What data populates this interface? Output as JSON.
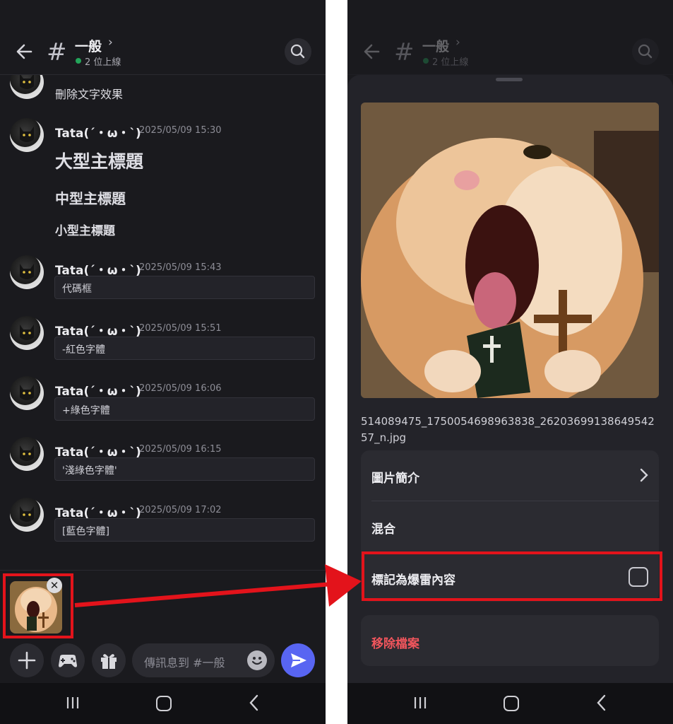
{
  "left": {
    "header": {
      "channel_name": "一般",
      "online_text": "2 位上線"
    },
    "messages": [
      {
        "author": "Tata(´・ω・`)",
        "timestamp": "2025/05/09 15:30",
        "h1": "大型主標題",
        "h2": "中型主標題",
        "h3": "小型主標題"
      },
      {
        "author": "Tata(´・ω・`)",
        "timestamp": "2025/05/09 15:43",
        "code": "代碼框"
      },
      {
        "author": "Tata(´・ω・`)",
        "timestamp": "2025/05/09 15:51",
        "code": "-紅色字體"
      },
      {
        "author": "Tata(´・ω・`)",
        "timestamp": "2025/05/09 16:06",
        "code": "+綠色字體"
      },
      {
        "author": "Tata(´・ω・`)",
        "timestamp": "2025/05/09 16:15",
        "code": "'淺綠色字體'"
      },
      {
        "author": "Tata(´・ω・`)",
        "timestamp": "2025/05/09 17:02",
        "code": "[藍色字體]"
      }
    ],
    "partial_top_text": "刪除文字效果",
    "composer": {
      "placeholder": "傳訊息到 #一般"
    }
  },
  "right": {
    "header": {
      "channel_name": "一般",
      "online_text": "2 位上線"
    },
    "filename": "514089475_1750054698963838_2620369913864954257_n.jpg",
    "options": {
      "description": "圖片簡介",
      "mix": "混合",
      "spoiler": "標記為爆雷內容",
      "spoiler_checked": false
    },
    "remove_label": "移除檔案"
  },
  "colors": {
    "background": "#1a1a1e",
    "sheet": "#232329",
    "accent_send": "#5865f2",
    "online": "#23a55a",
    "danger": "#f0555c",
    "highlight": "#e3131b"
  }
}
